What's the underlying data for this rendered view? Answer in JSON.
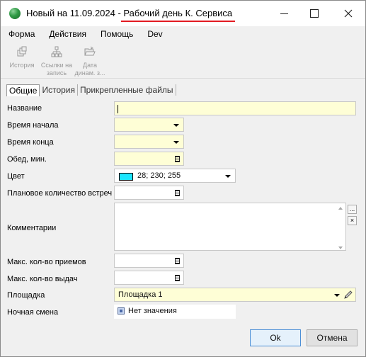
{
  "window": {
    "title_prefix": "Новый на 11.09.2024 - ",
    "title_sub": "Рабочий день К. Сервиса"
  },
  "menu": [
    "Форма",
    "Действия",
    "Помощь",
    "Dev"
  ],
  "toolbar": {
    "history": "История",
    "links_line1": "Ссылки на",
    "links_line2": "запись",
    "date_line1": "Дата",
    "date_line2": "динам. з..."
  },
  "tabs": [
    "Общие",
    "История",
    "Прикрепленные файлы"
  ],
  "form": {
    "name_label": "Название",
    "start_label": "Время начала",
    "end_label": "Время конца",
    "lunch_label": "Обед, мин.",
    "color_label": "Цвет",
    "color_value": "28; 230; 255",
    "color_hex": "#1ce6ff",
    "meetings_label": "Плановое количество встреч",
    "comments_label": "Комментарии",
    "max_receptions_label": "Макс. кол-во приемов",
    "max_issues_label": "Макс. кол-во выдач",
    "site_label": "Площадка",
    "site_value": "Площадка 1",
    "night_label": "Ночная смена",
    "night_value": "Нет значения",
    "more_btn": "...",
    "clear_btn": "×"
  },
  "buttons": {
    "ok": "Ok",
    "cancel": "Отмена"
  }
}
